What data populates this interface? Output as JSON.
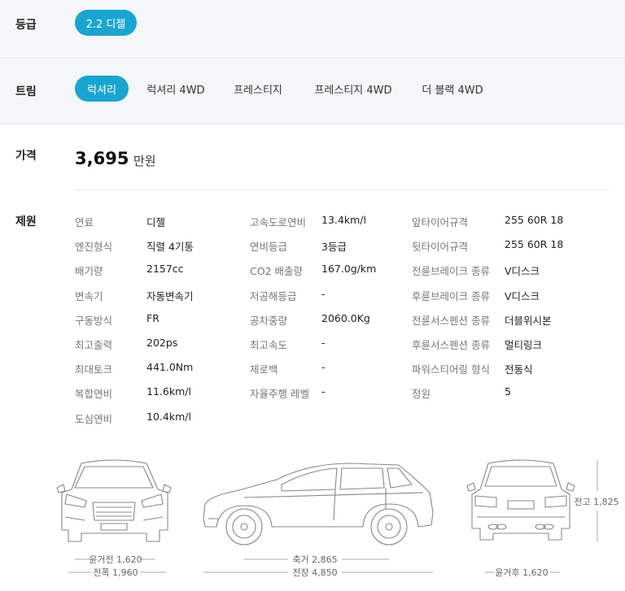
{
  "grade": {
    "label": "등급",
    "options": [
      "2.2 디젤"
    ],
    "selected": 0
  },
  "trim": {
    "label": "트림",
    "options": [
      "럭셔리",
      "럭셔리 4WD",
      "프레스티지",
      "프레스티지 4WD",
      "더 블랙 4WD"
    ],
    "selected": 0
  },
  "price": {
    "label": "가격",
    "value": "3,695",
    "unit": "만원"
  },
  "specs": {
    "label": "제원",
    "col1": [
      {
        "k": "연료",
        "v": "디젤"
      },
      {
        "k": "엔진형식",
        "v": "직렬 4기통"
      },
      {
        "k": "배기량",
        "v": "2157cc"
      },
      {
        "k": "변속기",
        "v": "자동변속기"
      },
      {
        "k": "구동방식",
        "v": "FR"
      },
      {
        "k": "최고출력",
        "v": "202ps"
      },
      {
        "k": "최대토크",
        "v": "441.0Nm"
      },
      {
        "k": "복합연비",
        "v": "11.6km/l"
      },
      {
        "k": "도심연비",
        "v": "10.4km/l"
      }
    ],
    "col2": [
      {
        "k": "고속도로연비",
        "v": "13.4km/l"
      },
      {
        "k": "연비등급",
        "v": "3등급"
      },
      {
        "k": "CO2 배출량",
        "v": "167.0g/km"
      },
      {
        "k": "저공해등급",
        "v": "-"
      },
      {
        "k": "공차중량",
        "v": "2060.0Kg"
      },
      {
        "k": "최고속도",
        "v": "-"
      },
      {
        "k": "제로백",
        "v": "-"
      },
      {
        "k": "자율주행 레벨",
        "v": "-"
      }
    ],
    "col3": [
      {
        "k": "앞타이어규격",
        "v": "255 60R 18"
      },
      {
        "k": "뒷타이어규격",
        "v": "255 60R 18"
      },
      {
        "k": "전륜브레이크 종류",
        "v": "V디스크"
      },
      {
        "k": "후륜브레이크 종류",
        "v": "V디스크"
      },
      {
        "k": "전륜서스펜션 종류",
        "v": "더블위시본"
      },
      {
        "k": "후륜서스펜션 종류",
        "v": "멀티링크"
      },
      {
        "k": "파워스티어링 형식",
        "v": "전동식"
      },
      {
        "k": "정원",
        "v": "5"
      }
    ]
  },
  "dimensions": {
    "front_track": "윤거전 1,620",
    "width": "전폭 1,960",
    "wheelbase": "축거 2,865",
    "length": "전장 4,850",
    "rear_track": "윤거후 1,620",
    "height": "전고 1,825"
  }
}
